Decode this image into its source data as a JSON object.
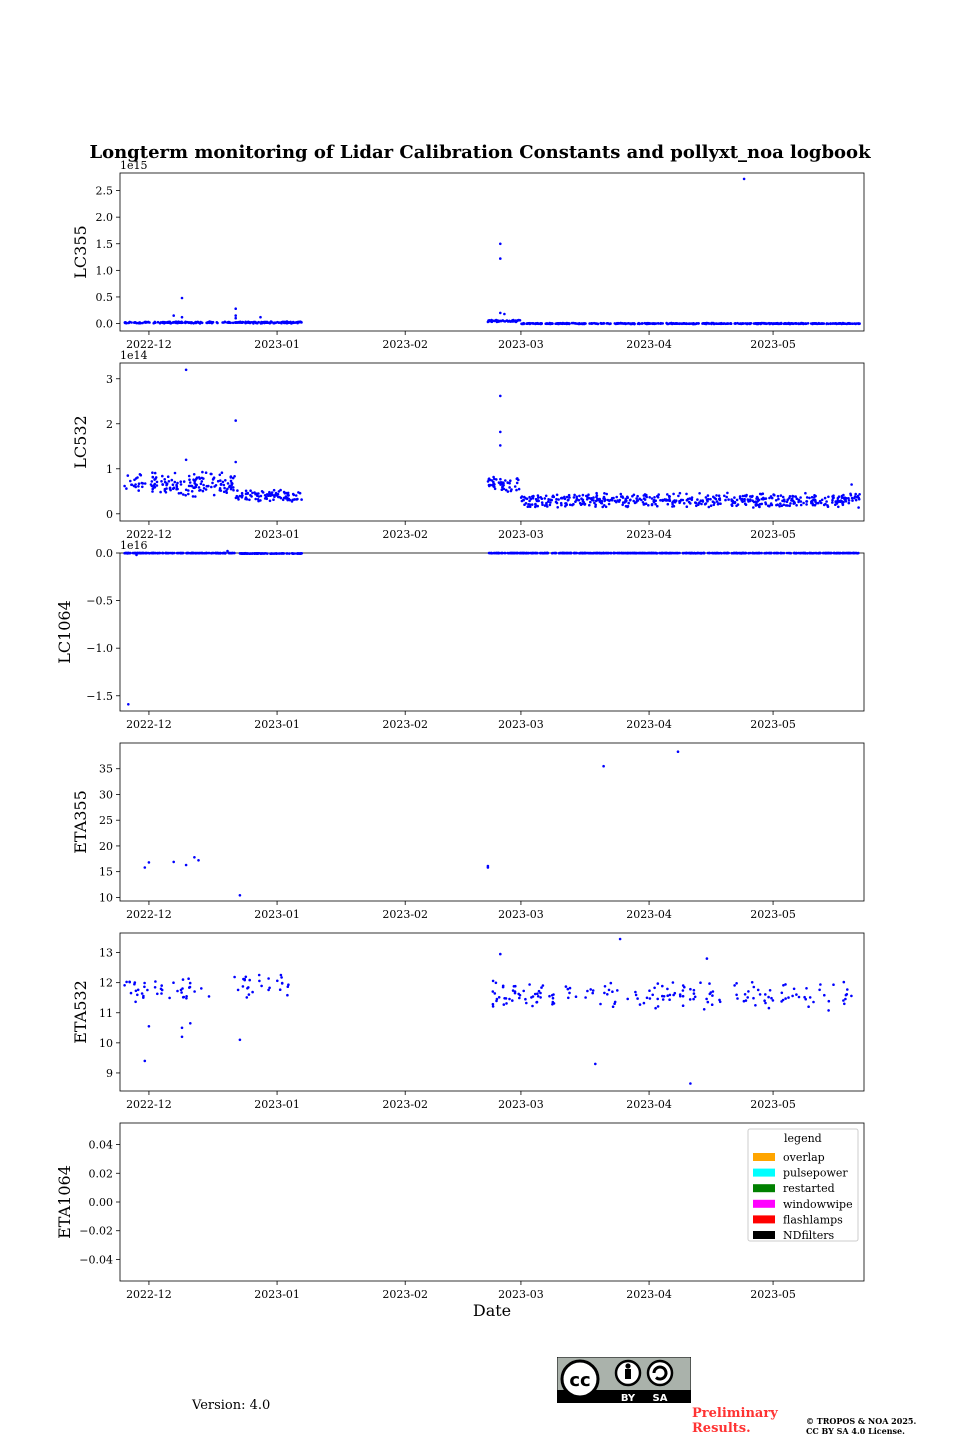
{
  "title": "Longterm monitoring of Lidar Calibration Constants and pollyxt_noa logbook",
  "version": "Version: 4.0",
  "preliminary": "Preliminary Results.",
  "copyright": [
    "© TROPOS & NOA 2025.",
    "CC BY SA 4.0 License."
  ],
  "license_badge": {
    "icon": "cc-by-sa-icon",
    "by": "BY",
    "sa": "SA"
  },
  "colors": {
    "points": "#0000ff",
    "axes": "#000000"
  },
  "chart_data": [
    {
      "type": "scatter",
      "ylabel": "LC355",
      "offset": "1e15",
      "x_range": [
        "2022-11-24",
        "2023-05-23"
      ],
      "x_ticks": [
        "2022-12",
        "2023-01",
        "2023-02",
        "2023-03",
        "2023-04",
        "2023-05"
      ],
      "ylim": [
        -0.14,
        2.83
      ],
      "y_ticks": [
        0.0,
        0.5,
        1.0,
        1.5,
        2.0,
        2.5
      ],
      "y_tick_labels": [
        "0.0",
        "0.5",
        "1.0",
        "1.5",
        "2.0",
        "2.5"
      ],
      "segments": [
        {
          "from": "2022-11-25",
          "to": "2023-01-07",
          "base": 0.02,
          "spread": 0.02
        },
        {
          "from": "2023-02-21",
          "to": "2023-03-01",
          "base": 0.05,
          "spread": 0.02
        },
        {
          "from": "2023-03-01",
          "to": "2023-05-22",
          "base": 0.0,
          "spread": 0.01
        }
      ],
      "points": [
        {
          "x": "2022-12-09",
          "y": 0.48
        },
        {
          "x": "2022-12-09",
          "y": 0.12
        },
        {
          "x": "2022-12-07",
          "y": 0.15
        },
        {
          "x": "2022-12-22",
          "y": 0.28
        },
        {
          "x": "2022-12-22",
          "y": 0.15
        },
        {
          "x": "2022-12-22",
          "y": 0.1
        },
        {
          "x": "2022-12-28",
          "y": 0.12
        },
        {
          "x": "2023-02-24",
          "y": 1.5
        },
        {
          "x": "2023-02-24",
          "y": 1.22
        },
        {
          "x": "2023-02-24",
          "y": 0.2
        },
        {
          "x": "2023-02-25",
          "y": 0.18
        },
        {
          "x": "2023-04-24",
          "y": 2.72
        }
      ]
    },
    {
      "type": "scatter",
      "ylabel": "LC532",
      "offset": "1e14",
      "x_range": [
        "2022-11-24",
        "2023-05-23"
      ],
      "x_ticks": [
        "2022-12",
        "2023-01",
        "2023-02",
        "2023-03",
        "2023-04",
        "2023-05"
      ],
      "ylim": [
        -0.16,
        3.35
      ],
      "y_ticks": [
        0,
        1,
        2,
        3
      ],
      "y_tick_labels": [
        "0",
        "1",
        "2",
        "3"
      ],
      "segments": [
        {
          "from": "2022-11-25",
          "to": "2022-12-22",
          "base": 0.65,
          "spread": 0.3
        },
        {
          "from": "2022-12-22",
          "to": "2023-01-07",
          "base": 0.4,
          "spread": 0.15
        },
        {
          "from": "2023-02-21",
          "to": "2023-03-01",
          "base": 0.65,
          "spread": 0.2
        },
        {
          "from": "2023-03-01",
          "to": "2023-05-22",
          "base": 0.3,
          "spread": 0.18
        }
      ],
      "points": [
        {
          "x": "2022-12-10",
          "y": 3.2
        },
        {
          "x": "2022-12-22",
          "y": 2.07
        },
        {
          "x": "2022-12-22",
          "y": 1.15
        },
        {
          "x": "2022-12-10",
          "y": 1.2
        },
        {
          "x": "2023-02-24",
          "y": 2.62
        },
        {
          "x": "2023-02-24",
          "y": 1.82
        },
        {
          "x": "2023-02-24",
          "y": 1.52
        },
        {
          "x": "2023-05-20",
          "y": 0.65
        }
      ]
    },
    {
      "type": "scatter",
      "ylabel": "LC1064",
      "offset": "1e16",
      "x_range": [
        "2022-11-24",
        "2023-05-23"
      ],
      "x_ticks": [
        "2022-12",
        "2023-01",
        "2023-02",
        "2023-03",
        "2023-04",
        "2023-05"
      ],
      "ylim": [
        -1.66,
        0.0
      ],
      "y_ticks": [
        0.0,
        -0.5,
        -1.0,
        -1.5
      ],
      "y_tick_labels": [
        "0.0",
        "−0.5",
        "−1.0",
        "−1.5"
      ],
      "segments": [
        {
          "from": "2022-11-25",
          "to": "2022-12-22",
          "base": 0.0,
          "spread": 0.005
        },
        {
          "from": "2022-12-23",
          "to": "2023-01-07",
          "base": -0.005,
          "spread": 0.003
        },
        {
          "from": "2023-02-21",
          "to": "2023-05-22",
          "base": 0.0,
          "spread": 0.004
        }
      ],
      "points": [
        {
          "x": "2022-11-26",
          "y": -1.59
        },
        {
          "x": "2022-12-20",
          "y": 0.02
        },
        {
          "x": "2022-11-28",
          "y": -0.02
        }
      ]
    },
    {
      "type": "scatter",
      "ylabel": "ETA355",
      "x_range": [
        "2022-11-24",
        "2023-05-23"
      ],
      "x_ticks": [
        "2022-12",
        "2023-01",
        "2023-02",
        "2023-03",
        "2023-04",
        "2023-05"
      ],
      "ylim": [
        9.3,
        40.0
      ],
      "y_ticks": [
        10,
        15,
        20,
        25,
        30,
        35
      ],
      "y_tick_labels": [
        "10",
        "15",
        "20",
        "25",
        "30",
        "35"
      ],
      "segments": [],
      "points": [
        {
          "x": "2022-11-30",
          "y": 15.8
        },
        {
          "x": "2022-12-01",
          "y": 16.8
        },
        {
          "x": "2022-12-07",
          "y": 16.9
        },
        {
          "x": "2022-12-10",
          "y": 16.3
        },
        {
          "x": "2022-12-12",
          "y": 17.8
        },
        {
          "x": "2022-12-13",
          "y": 17.2
        },
        {
          "x": "2022-12-23",
          "y": 10.4
        },
        {
          "x": "2023-02-21",
          "y": 15.8
        },
        {
          "x": "2023-02-21",
          "y": 16.1
        },
        {
          "x": "2023-03-21",
          "y": 35.5
        },
        {
          "x": "2023-04-08",
          "y": 38.3
        }
      ]
    },
    {
      "type": "scatter",
      "ylabel": "ETA532",
      "x_range": [
        "2022-11-24",
        "2023-05-23"
      ],
      "x_ticks": [
        "2022-12",
        "2023-01",
        "2023-02",
        "2023-03",
        "2023-04",
        "2023-05"
      ],
      "ylim": [
        8.4,
        13.65
      ],
      "y_ticks": [
        9,
        10,
        11,
        12,
        13
      ],
      "y_tick_labels": [
        "9",
        "10",
        "11",
        "12",
        "13"
      ],
      "segments": [
        {
          "from": "2022-11-25",
          "to": "2022-12-16",
          "base": 11.75,
          "spread": 0.45,
          "step": 0.5
        },
        {
          "from": "2022-12-21",
          "to": "2023-01-04",
          "base": 11.9,
          "spread": 0.45,
          "step": 0.5
        },
        {
          "from": "2023-02-21",
          "to": "2023-05-20",
          "base": 11.6,
          "spread": 0.55,
          "step": 0.5
        }
      ],
      "points": [
        {
          "x": "2022-11-30",
          "y": 9.4
        },
        {
          "x": "2022-12-01",
          "y": 10.55
        },
        {
          "x": "2022-12-09",
          "y": 10.2
        },
        {
          "x": "2022-12-09",
          "y": 10.5
        },
        {
          "x": "2022-12-11",
          "y": 10.65
        },
        {
          "x": "2022-12-23",
          "y": 10.1
        },
        {
          "x": "2023-02-24",
          "y": 12.95
        },
        {
          "x": "2023-03-19",
          "y": 9.3
        },
        {
          "x": "2023-03-25",
          "y": 13.45
        },
        {
          "x": "2023-04-11",
          "y": 8.65
        },
        {
          "x": "2023-04-15",
          "y": 12.8
        }
      ]
    },
    {
      "type": "scatter",
      "ylabel": "ETA1064",
      "xlabel": "Date",
      "x_range": [
        "2022-11-24",
        "2023-05-23"
      ],
      "x_ticks": [
        "2022-12",
        "2023-01",
        "2023-02",
        "2023-03",
        "2023-04",
        "2023-05"
      ],
      "ylim": [
        -0.055,
        0.055
      ],
      "y_ticks": [
        0.04,
        0.02,
        0.0,
        -0.02,
        -0.04
      ],
      "y_tick_labels": [
        "0.04",
        "0.02",
        "0.00",
        "−0.02",
        "−0.04"
      ],
      "segments": [],
      "points": [],
      "legend": {
        "title": "legend",
        "position": "top-right",
        "entries": [
          {
            "label": "overlap",
            "color": "#ffa500"
          },
          {
            "label": "pulsepower",
            "color": "#00ffff"
          },
          {
            "label": "restarted",
            "color": "#008000"
          },
          {
            "label": "windowwipe",
            "color": "#ff00ff"
          },
          {
            "label": "flashlamps",
            "color": "#ff0000"
          },
          {
            "label": "NDfilters",
            "color": "#000000"
          }
        ]
      }
    }
  ]
}
